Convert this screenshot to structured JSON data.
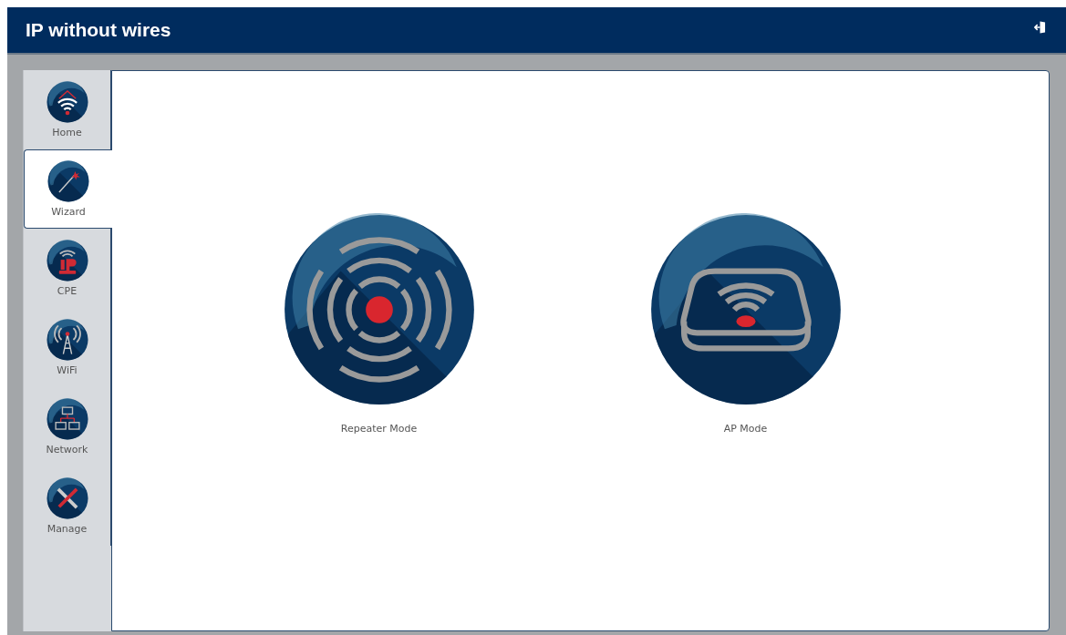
{
  "header": {
    "title": "IP without wires"
  },
  "sidebar": {
    "items": [
      {
        "label": "Home",
        "kind": "home",
        "selected": false
      },
      {
        "label": "Wizard",
        "kind": "wizard",
        "selected": true
      },
      {
        "label": "CPE",
        "kind": "cpe",
        "selected": false
      },
      {
        "label": "WiFi",
        "kind": "wifi",
        "selected": false
      },
      {
        "label": "Network",
        "kind": "network",
        "selected": false
      },
      {
        "label": "Manage",
        "kind": "manage",
        "selected": false
      }
    ]
  },
  "modes": [
    {
      "label": "Repeater Mode",
      "kind": "repeater"
    },
    {
      "label": "AP Mode",
      "kind": "ap"
    }
  ]
}
